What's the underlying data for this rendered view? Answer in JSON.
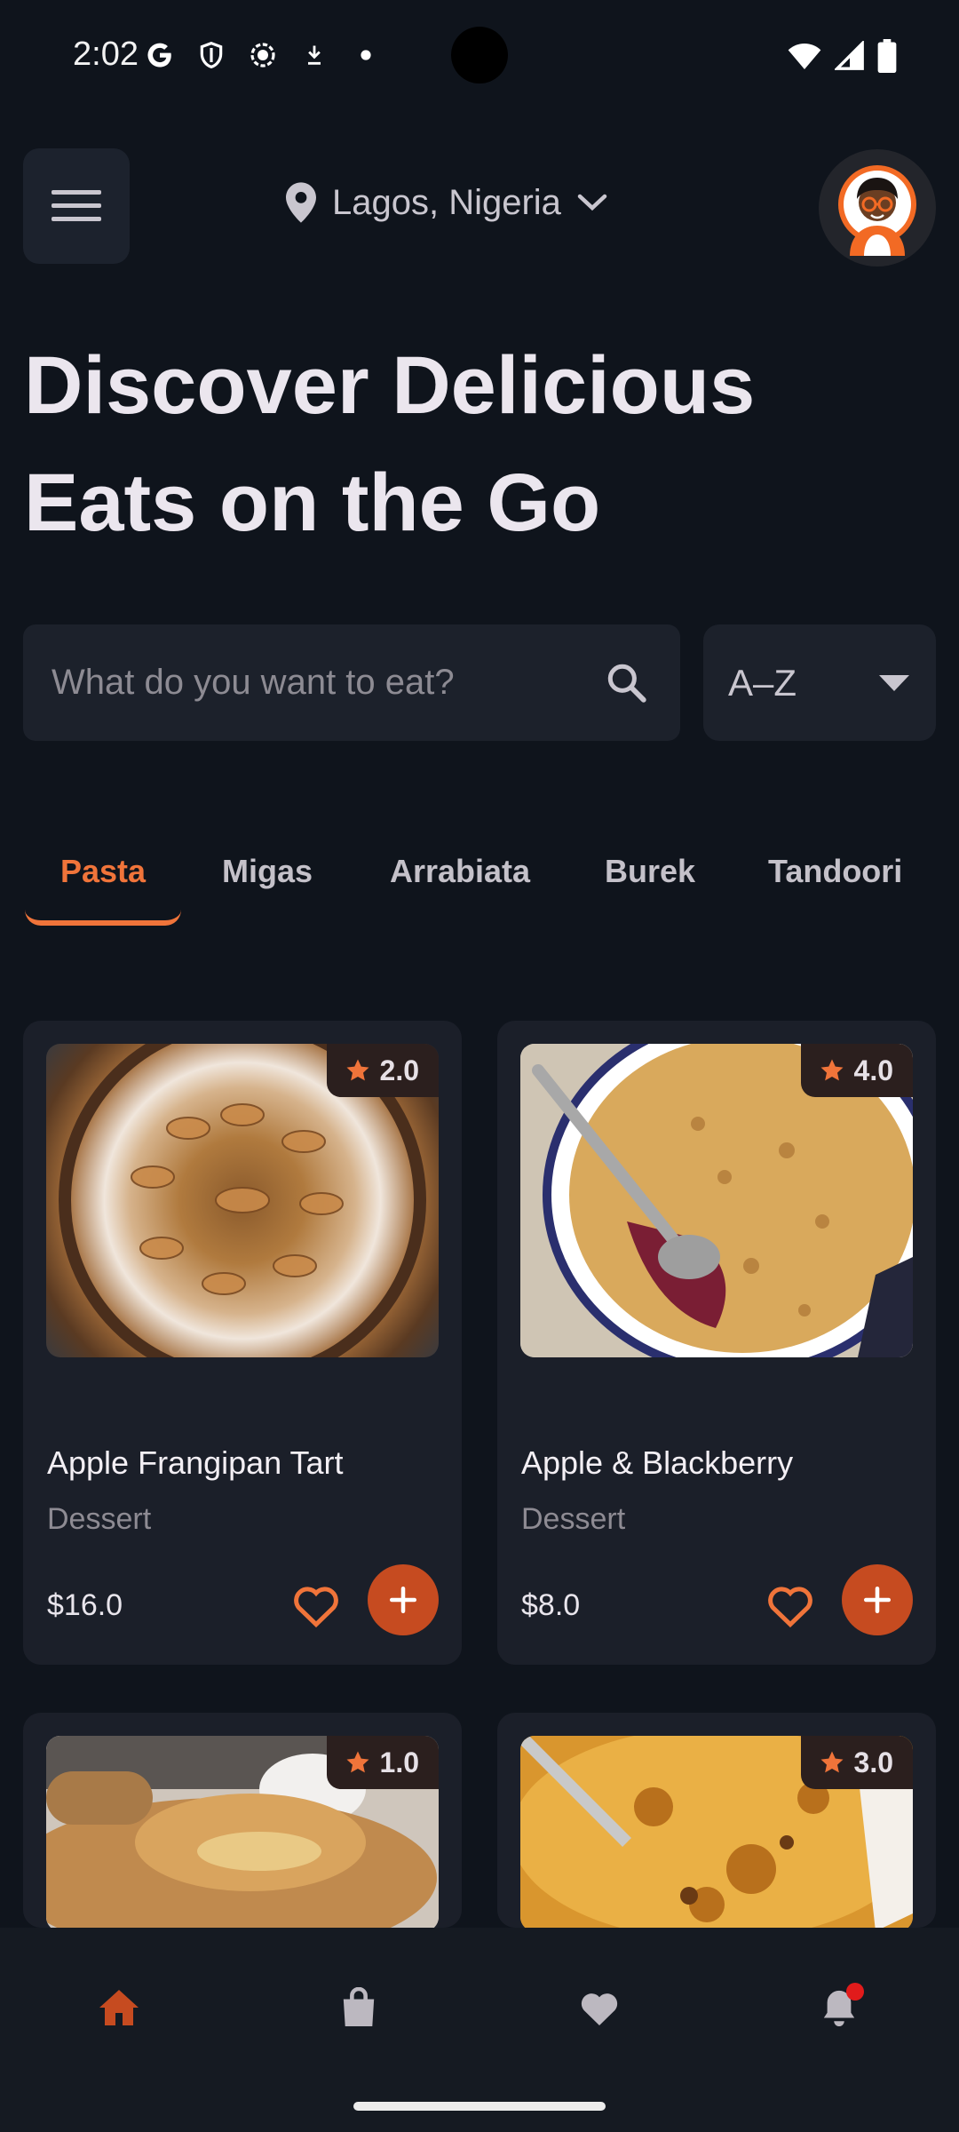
{
  "status_bar": {
    "time": "2:02",
    "left_icons": [
      "google-icon",
      "shield-icon",
      "record-icon",
      "download-icon",
      "dot-icon"
    ],
    "right_icons": [
      "wifi-icon",
      "signal-icon",
      "battery-icon"
    ]
  },
  "header": {
    "location": "Lagos, Nigeria",
    "icons": [
      "menu-icon",
      "location-pin-icon",
      "chevron-down-icon",
      "avatar"
    ]
  },
  "title": {
    "line1": "Discover Delicious",
    "line2": "Eats on the Go"
  },
  "search": {
    "placeholder": "What do you want to eat?",
    "sort_value": "A–Z"
  },
  "tabs": [
    {
      "label": "Pasta",
      "active": true
    },
    {
      "label": "Migas",
      "active": false
    },
    {
      "label": "Arrabiata",
      "active": false
    },
    {
      "label": "Burek",
      "active": false
    },
    {
      "label": "Tandoori",
      "active": false
    }
  ],
  "products": [
    {
      "name": "Apple Frangipan Tart",
      "category": "Dessert",
      "price": "$16.0",
      "rating": "2.0"
    },
    {
      "name": "Apple & Blackberry",
      "category": "Dessert",
      "price": "$8.0",
      "rating": "4.0"
    },
    {
      "name": "",
      "category": "",
      "price": "",
      "rating": "1.0"
    },
    {
      "name": "",
      "category": "",
      "price": "",
      "rating": "3.0"
    }
  ],
  "bottom_nav": [
    "home-icon",
    "bag-icon",
    "heart-icon",
    "bell-icon"
  ],
  "colors": {
    "background": "#0f141c",
    "surface": "#1b1f29",
    "accent": "#f0743a",
    "add_button": "#c64b20",
    "notification": "#e11b1b"
  }
}
